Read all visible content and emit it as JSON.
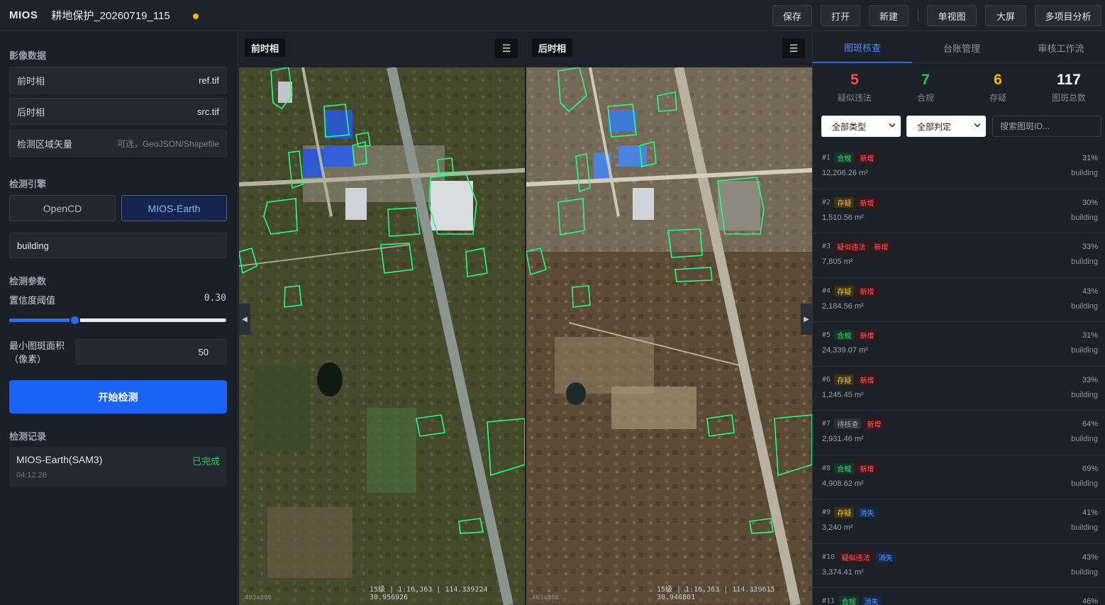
{
  "app": {
    "brand": "MIOS",
    "project_name": "耕地保护_20260719_115",
    "toolbar": [
      "保存",
      "打开",
      "新建",
      "单视图",
      "大屏",
      "多项目分析"
    ]
  },
  "left": {
    "imagery_title": "影像数据",
    "fields": [
      {
        "label": "前时相",
        "value": "ref.tif"
      },
      {
        "label": "后时相",
        "value": "src.tif"
      },
      {
        "label": "检测区域矢量",
        "value": "可选，GeoJSON/Shapefile"
      }
    ],
    "engine_title": "检测引擎",
    "engines": [
      "OpenCD",
      "MIOS-Earth"
    ],
    "selected_engine": "MIOS-Earth",
    "prompt_value": "building",
    "params_title": "检测参数",
    "confidence_label": "置信度阈值",
    "confidence_value": "0.30",
    "confidence_fraction": 0.3,
    "min_area_label": "最小图斑面积\n（像素）",
    "min_area_value": "50",
    "start_button": "开始检测",
    "records_title": "检测记录",
    "record": {
      "name": "MIOS-Earth(SAM3)",
      "status": "已完成",
      "time": "04:12:26"
    }
  },
  "maps": {
    "before": {
      "label": "前时相",
      "menu_icon": "menu-icon",
      "size": "403x808",
      "footer": "15级 | 1:16,363 | 114.339224 30.956926"
    },
    "after": {
      "label": "后时相",
      "menu_icon": "menu-icon",
      "size": "403x808",
      "footer": "15级 | 1:16,363 | 114.339615 30.946801"
    }
  },
  "right": {
    "tabs": [
      "图斑核查",
      "台账管理",
      "审核工作流"
    ],
    "active_tab": "图斑核查",
    "stats": [
      {
        "value": "5",
        "label": "疑似违法",
        "color": "#ff4d4f"
      },
      {
        "value": "7",
        "label": "合规",
        "color": "#22c55e"
      },
      {
        "value": "6",
        "label": "存疑",
        "color": "#f5b800"
      },
      {
        "value": "117",
        "label": "图斑总数",
        "color": "#ffffff"
      }
    ],
    "filter_type": "全部类型",
    "filter_judge": "全部判定",
    "search_placeholder": "搜索图斑ID...",
    "items": [
      {
        "id": "#1",
        "verdict": "合规",
        "change": "新增",
        "area": "12,206.26 m²",
        "pct": "31%",
        "cls": "building"
      },
      {
        "id": "#2",
        "verdict": "存疑",
        "change": "新增",
        "area": "1,510.56 m²",
        "pct": "30%",
        "cls": "building"
      },
      {
        "id": "#3",
        "verdict": "疑似违法",
        "change": "新增",
        "area": "7,805 m²",
        "pct": "33%",
        "cls": "building"
      },
      {
        "id": "#4",
        "verdict": "存疑",
        "change": "新增",
        "area": "2,184.56 m²",
        "pct": "43%",
        "cls": "building"
      },
      {
        "id": "#5",
        "verdict": "合规",
        "change": "新增",
        "area": "24,339.07 m²",
        "pct": "31%",
        "cls": "building"
      },
      {
        "id": "#6",
        "verdict": "存疑",
        "change": "新增",
        "area": "1,245.45 m²",
        "pct": "33%",
        "cls": "building"
      },
      {
        "id": "#7",
        "verdict": "待核查",
        "change": "新增",
        "area": "2,931.46 m²",
        "pct": "64%",
        "cls": "building"
      },
      {
        "id": "#8",
        "verdict": "合规",
        "change": "新增",
        "area": "4,908.62 m²",
        "pct": "69%",
        "cls": "building"
      },
      {
        "id": "#9",
        "verdict": "存疑",
        "change": "消失",
        "area": "3,240 m²",
        "pct": "41%",
        "cls": "building"
      },
      {
        "id": "#10",
        "verdict": "疑似违法",
        "change": "消失",
        "area": "3,374.41 m²",
        "pct": "43%",
        "cls": "building"
      },
      {
        "id": "#11",
        "verdict": "合规",
        "change": "消失",
        "area": "",
        "pct": "46%",
        "cls": ""
      }
    ]
  }
}
